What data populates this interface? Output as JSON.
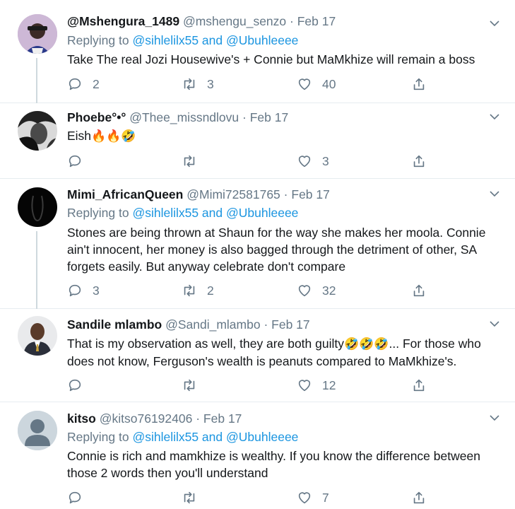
{
  "tweets": [
    {
      "name": "@Mshengura_1489",
      "handle": "@mshengu_senzo",
      "dot": "·",
      "date": "Feb 17",
      "replying_prefix": "Replying to",
      "replying_mentions": "@sihlelilx55 and @Ubuhleeee",
      "text": "Take The real Jozi Housewive's + Connie but MaMkhize will remain a boss",
      "replies": "2",
      "retweets": "3",
      "likes": "40"
    },
    {
      "name": "Phoebe°•°",
      "handle": "@Thee_missndlovu",
      "dot": "·",
      "date": "Feb 17",
      "text": "Eish",
      "emojis": "🔥🔥🤣",
      "replies": "",
      "retweets": "",
      "likes": "3"
    },
    {
      "name": "Mimi_AfricanQueen",
      "handle": "@Mimi72581765",
      "dot": "·",
      "date": "Feb 17",
      "replying_prefix": "Replying to",
      "replying_mentions": "@sihlelilx55 and @Ubuhleeee",
      "text_lines": [
        "Stones are being thrown at Shaun for the way she makes her moola. Connie",
        "ain't innocent, her money is also bagged through the detriment of other, SA",
        "forgets easily. But anyway celebrate don't compare"
      ],
      "replies": "3",
      "retweets": "2",
      "likes": "32"
    },
    {
      "name": "Sandile mlambo",
      "handle": "@Sandi_mlambo",
      "dot": "·",
      "date": "Feb 17",
      "text_line1_a": "That is my observation as well, they are both guilty",
      "text_line1_emojis": "🤣🤣🤣",
      "text_line1_b": "... For those who",
      "text_line2": "does not know, Ferguson's wealth is peanuts compared to MaMkhize's.",
      "replies": "",
      "retweets": "",
      "likes": "12"
    },
    {
      "name": "kitso",
      "handle": "@kitso76192406",
      "dot": "·",
      "date": "Feb 17",
      "replying_prefix": "Replying to",
      "replying_mentions": "@sihlelilx55 and @Ubuhleeee",
      "text_lines": [
        "Connie is rich and mamkhize is wealthy. If you know the difference between",
        "those 2 words then you'll understand"
      ],
      "replies": "",
      "retweets": "",
      "likes": "7"
    }
  ],
  "icons": {
    "reply": "reply-icon",
    "retweet": "retweet-icon",
    "like": "heart-icon",
    "share": "share-icon",
    "caret": "chevron-down-icon"
  },
  "colors": {
    "link": "#1b95e0",
    "muted": "#657786",
    "text": "#14171a",
    "border": "#e6ecf0"
  }
}
